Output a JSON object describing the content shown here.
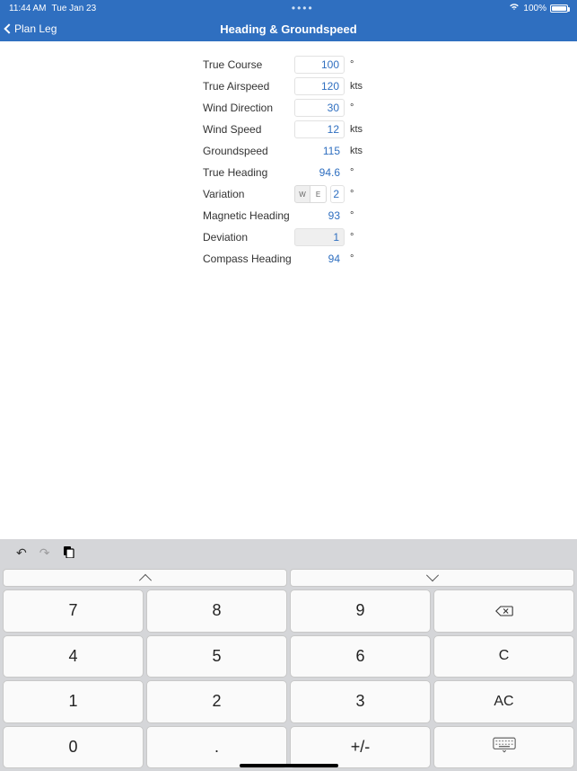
{
  "status": {
    "time": "11:44 AM",
    "date": "Tue Jan 23",
    "battery": "100%"
  },
  "nav": {
    "back": "Plan Leg",
    "title": "Heading & Groundspeed"
  },
  "fields": {
    "true_course": {
      "label": "True Course",
      "value": "100",
      "unit": "°",
      "mode": "input"
    },
    "true_airspeed": {
      "label": "True Airspeed",
      "value": "120",
      "unit": "kts",
      "mode": "input"
    },
    "wind_direction": {
      "label": "Wind Direction",
      "value": "30",
      "unit": "°",
      "mode": "input"
    },
    "wind_speed": {
      "label": "Wind Speed",
      "value": "12",
      "unit": "kts",
      "mode": "input"
    },
    "groundspeed": {
      "label": "Groundspeed",
      "value": "115",
      "unit": "kts",
      "mode": "readonly"
    },
    "true_heading": {
      "label": "True Heading",
      "value": "94.6",
      "unit": "°",
      "mode": "readonly"
    },
    "variation": {
      "label": "Variation",
      "value": "2",
      "unit": "°",
      "mode": "toggle-input",
      "toggle": {
        "left": "W",
        "right": "E",
        "selected": "W"
      }
    },
    "magnetic_heading": {
      "label": "Magnetic Heading",
      "value": "93",
      "unit": "°",
      "mode": "readonly"
    },
    "deviation": {
      "label": "Deviation",
      "value": "1",
      "unit": "°",
      "mode": "highlight"
    },
    "compass_heading": {
      "label": "Compass Heading",
      "value": "94",
      "unit": "°",
      "mode": "readonly"
    }
  },
  "keypad": {
    "row1": [
      "7",
      "8",
      "9"
    ],
    "row2": [
      "4",
      "5",
      "6"
    ],
    "row3": [
      "1",
      "2",
      "3"
    ],
    "row4": [
      "0",
      ".",
      "+/-"
    ],
    "fn": {
      "clear": "C",
      "allclear": "AC"
    }
  }
}
